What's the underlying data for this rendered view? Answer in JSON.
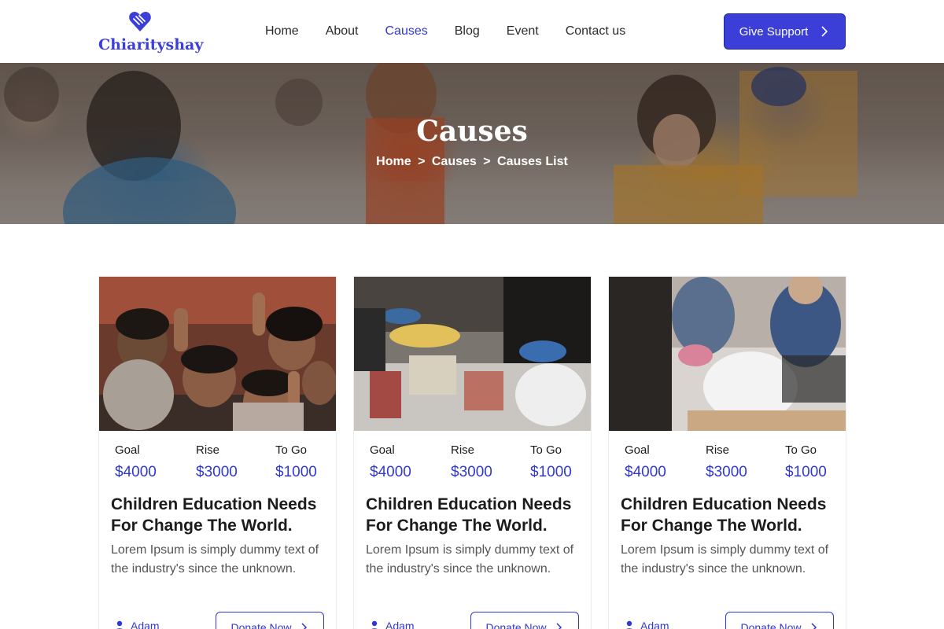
{
  "header": {
    "logo_text": "Chiarityshay",
    "nav": [
      {
        "label": "Home",
        "active": false
      },
      {
        "label": "About",
        "active": false
      },
      {
        "label": "Causes",
        "active": true
      },
      {
        "label": "Blog",
        "active": false
      },
      {
        "label": "Event",
        "active": false
      },
      {
        "label": "Contact us",
        "active": false
      }
    ],
    "cta_label": "Give Support"
  },
  "hero": {
    "title": "Causes",
    "breadcrumb": [
      "Home",
      ">",
      "Causes",
      ">",
      "Causes List"
    ]
  },
  "colors": {
    "accent": "#3b3fd8",
    "link": "#3038d4",
    "text": "#1c1c1c",
    "muted": "#555555"
  },
  "cards": [
    {
      "image": "children-smiling-photo",
      "stats": [
        {
          "label": "Goal",
          "value": "$4000"
        },
        {
          "label": "Rise",
          "value": "$3000"
        },
        {
          "label": "To Go",
          "value": "$1000"
        }
      ],
      "title": "Children Education Needs For Change The World.",
      "description": "Lorem Ipsum is simply dummy text of the industry's since the unknown.",
      "author": "Adam",
      "donate_label": "Donate Now"
    },
    {
      "image": "food-drive-photo",
      "stats": [
        {
          "label": "Goal",
          "value": "$4000"
        },
        {
          "label": "Rise",
          "value": "$3000"
        },
        {
          "label": "To Go",
          "value": "$1000"
        }
      ],
      "title": "Children Education Needs For Change The World.",
      "description": "Lorem Ipsum is simply dummy text of the industry's since the unknown.",
      "author": "Adam",
      "donate_label": "Donate Now"
    },
    {
      "image": "volunteers-packing-photo",
      "stats": [
        {
          "label": "Goal",
          "value": "$4000"
        },
        {
          "label": "Rise",
          "value": "$3000"
        },
        {
          "label": "To Go",
          "value": "$1000"
        }
      ],
      "title": "Children Education Needs For Change The World.",
      "description": "Lorem Ipsum is simply dummy text of the industry's since the unknown.",
      "author": "Adam",
      "donate_label": "Donate Now"
    }
  ]
}
